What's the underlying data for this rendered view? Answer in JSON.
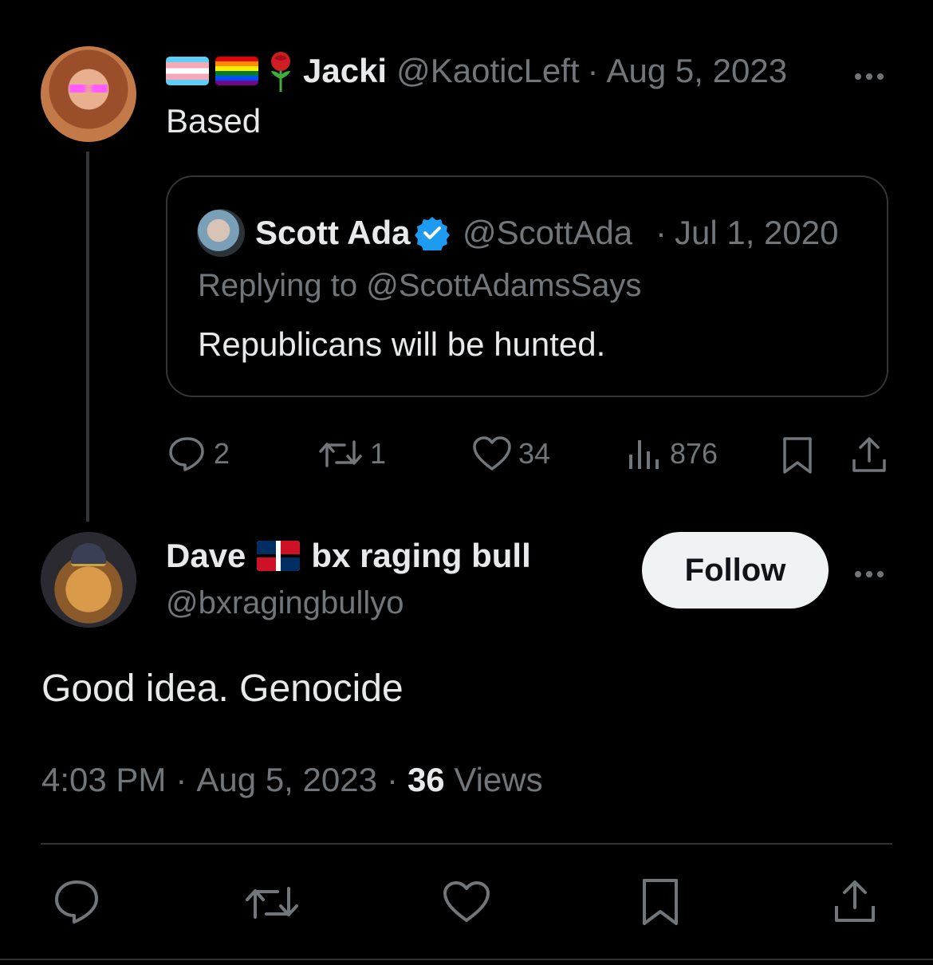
{
  "original_tweet": {
    "display_name": "Jacki",
    "handle": "@KaoticLeft",
    "separator": "·",
    "date": "Aug 5, 2023",
    "text": "Based",
    "stats": {
      "replies": "2",
      "reposts": "1",
      "likes": "34",
      "views": "876"
    }
  },
  "quoted_tweet": {
    "display_name": "Scott Ada",
    "handle": "@ScottAda",
    "separator": "·",
    "date": "Jul 1, 2020",
    "replying_prefix": "Replying to",
    "replying_handle": "@ScottAdamsSays",
    "text": "Republicans will be hunted."
  },
  "reply_tweet": {
    "display_name_first": "Dave",
    "display_name_rest": "bx raging bull",
    "handle": "@bxragingbullyo",
    "follow_label": "Follow",
    "text": "Good idea. Genocide",
    "time": "4:03 PM",
    "separator": "·",
    "date": "Aug 5, 2023",
    "views_count": "36",
    "views_label": "Views"
  },
  "colors": {
    "background": "#000000",
    "text": "#e7e9ea",
    "muted": "#71767b",
    "verified": "#1d9bf0",
    "border": "#2f3336"
  }
}
